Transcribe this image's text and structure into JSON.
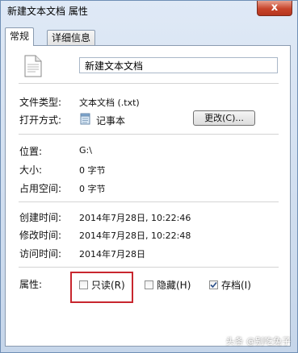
{
  "window": {
    "title": "新建文本文档 属性",
    "close_glyph": "x"
  },
  "tabs": [
    {
      "label": "常规",
      "active": true
    },
    {
      "label": "详细信息",
      "active": false
    }
  ],
  "general": {
    "file_name": "新建文本文档",
    "file_type_label": "文件类型:",
    "file_type_value": "文本文档 (.txt)",
    "open_with_label": "打开方式:",
    "open_with_value": "记事本",
    "change_button": "更改(C)...",
    "location_label": "位置:",
    "location_value": "G:\\",
    "size_label": "大小:",
    "size_value": "0 字节",
    "size_on_disk_label": "占用空间:",
    "size_on_disk_value": "0 字节",
    "created_label": "创建时间:",
    "created_value": "2014年7月28日, 10:22:46",
    "modified_label": "修改时间:",
    "modified_value": "2014年7月28日, 10:22:48",
    "accessed_label": "访问时间:",
    "accessed_value": "2014年7月28日",
    "attributes_label": "属性:",
    "attributes": [
      {
        "label": "只读(R)",
        "checked": false
      },
      {
        "label": "隐藏(H)",
        "checked": false
      },
      {
        "label": "存档(I)",
        "checked": true
      }
    ]
  },
  "icons": {
    "file": "text-document-icon",
    "app": "notepad-icon"
  },
  "colors": {
    "highlight": "#c8262e",
    "close": "#c7442b"
  },
  "watermark": "头条 @别吃兔子"
}
